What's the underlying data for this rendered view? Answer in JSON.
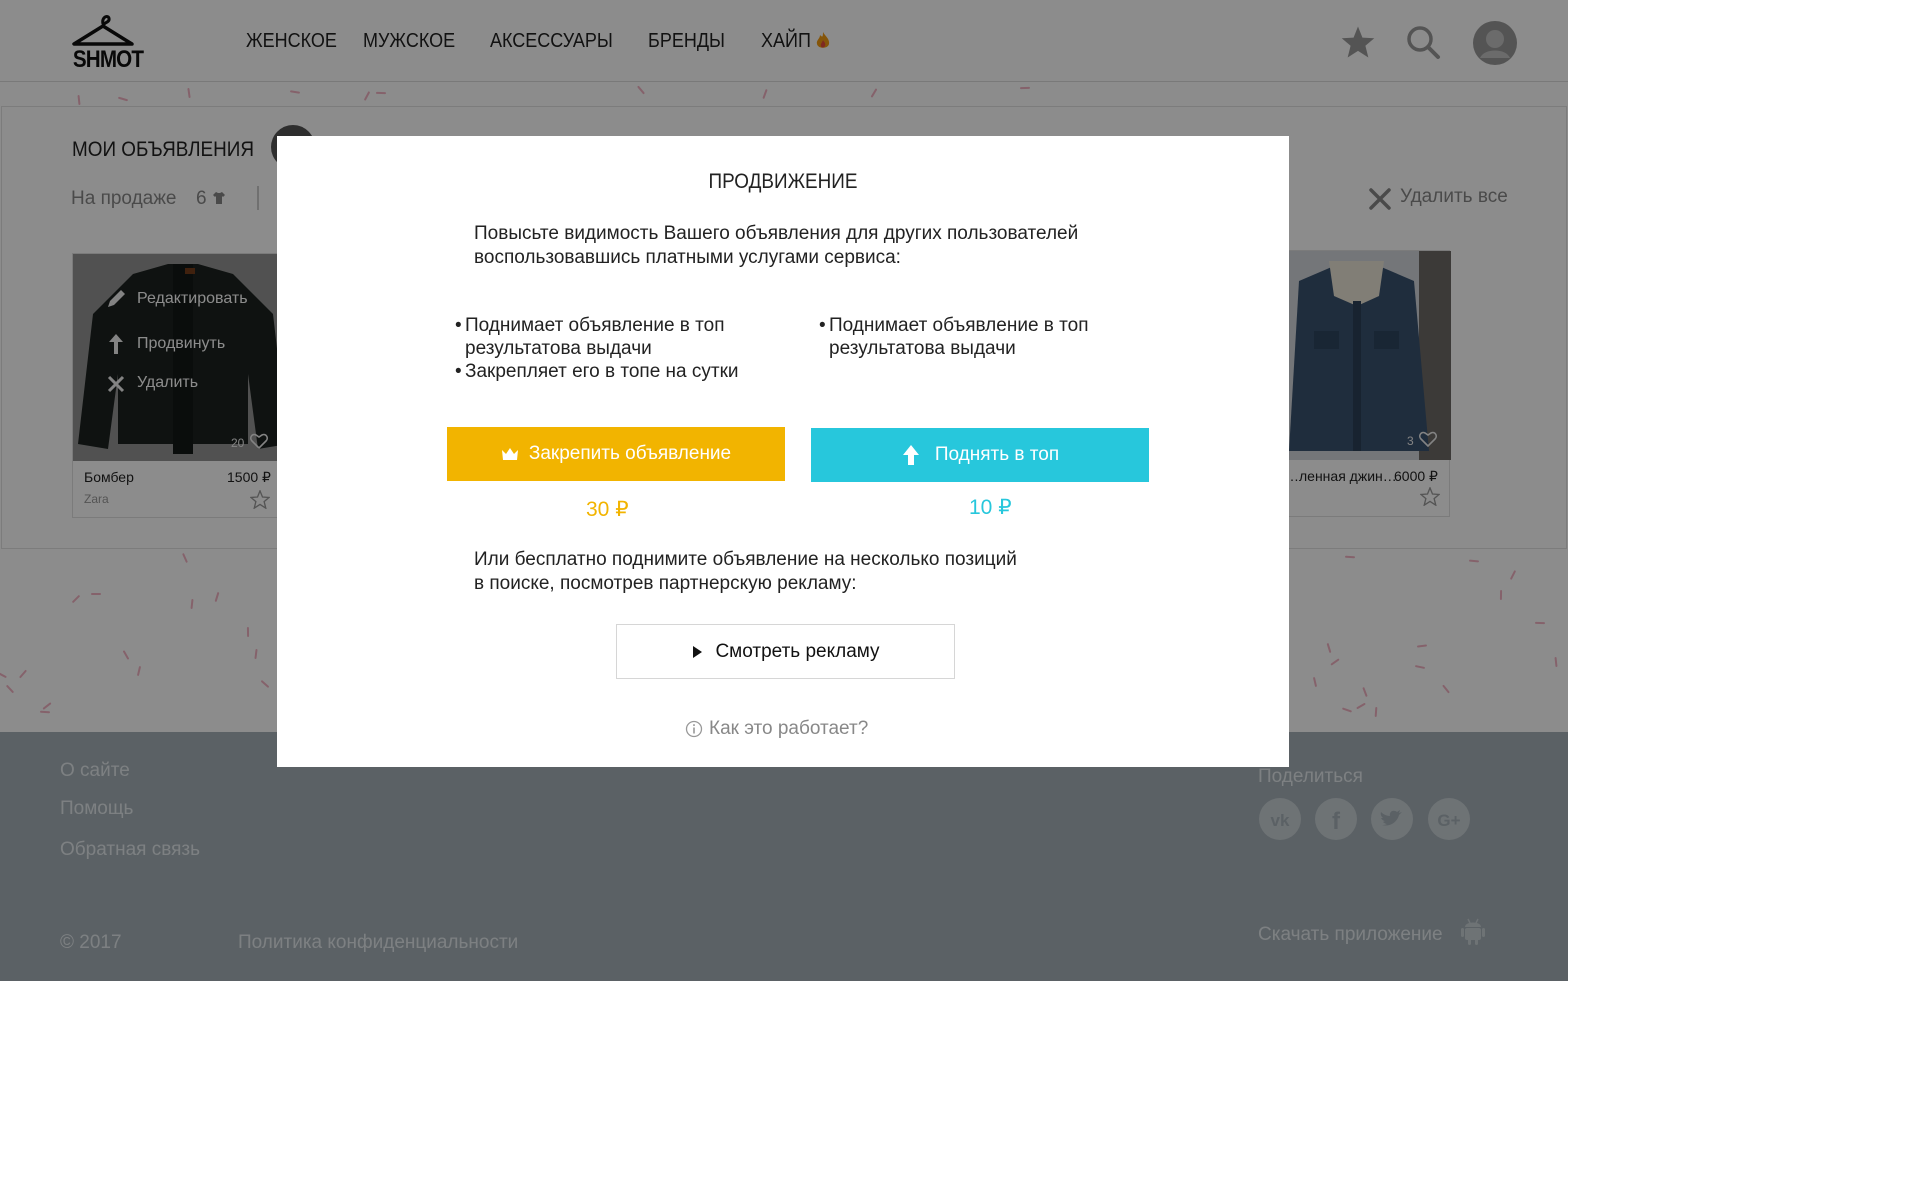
{
  "header": {
    "logo_text": "SHMOT",
    "nav": [
      "ЖЕНСКОЕ",
      "МУЖСКОЕ",
      "АКСЕССУАРЫ",
      "БРЕНДЫ",
      "ХАЙП"
    ],
    "icons": [
      "star-icon",
      "search-icon",
      "avatar-icon"
    ]
  },
  "main": {
    "title": "МОИ ОБЪЯВЛЕНИЯ",
    "tab_label": "На продаже",
    "tab_count": "6",
    "delete_all": "Удалить все",
    "cards": [
      {
        "name": "Бомбер",
        "brand": "Zara",
        "price": "1500 ₽",
        "likes": "20",
        "menu": [
          "Редактировать",
          "Продвинуть",
          "Удалить"
        ]
      },
      {
        "name": "…ленная джин…",
        "price": "6000 ₽",
        "likes": "3"
      }
    ]
  },
  "modal": {
    "title": "ПРОДВИЖЕНИЕ",
    "intro_line1": "Повысьте видимость Вашего объявления для других пользователей",
    "intro_line2": "воспользовавшись платными услугами сервиса:",
    "left_bullets": [
      "Поднимает объявление в  топ результатова выдачи",
      "Закрепляет его в топе на сутки"
    ],
    "right_bullets": [
      "Поднимает объявление в топ результатова выдачи"
    ],
    "pin_button": "Закрепить объявление",
    "pin_price": "30 ₽",
    "top_button": "Поднять в топ",
    "top_price": "10 ₽",
    "free_line1": "Или бесплатно поднимите объявление на несколько позиций",
    "free_line2": "в поиске, посмотрев партнерскую рекламу:",
    "ad_button": "Смотреть рекламу",
    "how_link": "Как это работает?"
  },
  "footer": {
    "links": [
      "О сайте",
      "Помощь",
      "Обратная связь"
    ],
    "copyright": "© 2017",
    "privacy": "Политика конфиденциальности",
    "share_label": "Поделиться",
    "social": [
      "vk-icon",
      "facebook-icon",
      "twitter-icon",
      "google-plus-icon"
    ],
    "app_label": "Скачать приложение"
  },
  "colors": {
    "pin": "#f2b400",
    "top": "#27c7dc",
    "footer": "#a6b1b8",
    "confetti": "#f3b3c4"
  }
}
